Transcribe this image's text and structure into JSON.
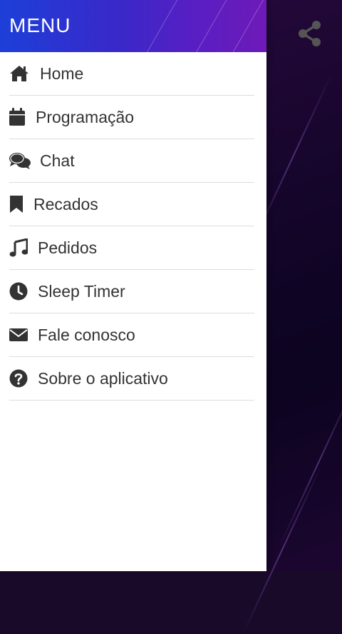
{
  "drawer": {
    "title": "MENU",
    "items": [
      {
        "label": "Home",
        "icon": "home-icon"
      },
      {
        "label": "Programação",
        "icon": "calendar-icon"
      },
      {
        "label": "Chat",
        "icon": "chat-icon"
      },
      {
        "label": "Recados",
        "icon": "bookmark-icon"
      },
      {
        "label": "Pedidos",
        "icon": "music-note-icon"
      },
      {
        "label": "Sleep Timer",
        "icon": "clock-icon"
      },
      {
        "label": "Fale conosco",
        "icon": "envelope-icon"
      },
      {
        "label": "Sobre o aplicativo",
        "icon": "question-circle-icon"
      }
    ]
  },
  "toolbar": {
    "share_icon": "share-icon"
  },
  "colors": {
    "header_start": "#1d3fd8",
    "header_end": "#6e1ab8",
    "icon": "#333333",
    "text": "#333333",
    "divider": "#dcdcdc",
    "share_icon": "#555555"
  }
}
